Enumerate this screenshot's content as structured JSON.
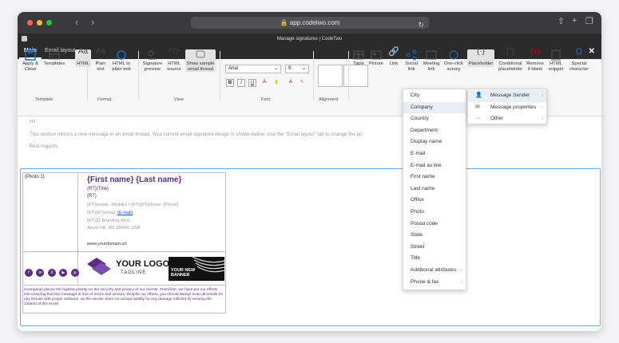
{
  "browser": {
    "url": "app.codetwo.com"
  },
  "app": {
    "title": "Manage signatures | CodeTwo"
  },
  "tabs": [
    {
      "label": "Main"
    },
    {
      "label": "Email layout"
    }
  ],
  "ribbon": {
    "template": [
      {
        "label": "Apply & Close"
      },
      {
        "label": "Templates"
      }
    ],
    "format": [
      {
        "label": "HTML"
      },
      {
        "label": "Plain text"
      },
      {
        "label": "HTML to plain text"
      }
    ],
    "view": [
      {
        "label": "Signature preview"
      },
      {
        "label": "HTML source"
      },
      {
        "label": "Show sample email thread"
      }
    ],
    "font": {
      "family": "Arial",
      "size": "9",
      "bold": "B",
      "italic": "I",
      "underline": "U"
    },
    "insert": [
      {
        "label": "Table"
      },
      {
        "label": "Picture"
      },
      {
        "label": "Link"
      },
      {
        "label": "Social link"
      },
      {
        "label": "Meeting link"
      },
      {
        "label": "One-click survey"
      },
      {
        "label": "Placeholder"
      },
      {
        "label": "Conditional placeholder"
      },
      {
        "label": "Remove if blank"
      },
      {
        "label": "HTML snippet"
      },
      {
        "label": "Special character"
      }
    ],
    "groups": {
      "template": "Template",
      "format": "Format",
      "view": "View",
      "font": "Font",
      "alignment": "Alignment"
    }
  },
  "email": {
    "hi": "Hi!",
    "body": "This section mimics a new message in an email thread. Your current email signature design is shown below. Use the \"Email layout\" tab to change the po",
    "regards": "Best regards,"
  },
  "signature": {
    "photo": "{Photo 1}",
    "name": "{First name} {Last name}",
    "title": "{RT}{Title}",
    "rt": "{RT}",
    "mobile": "{RT}mobile: {Mobile} • {RT}{RT}phone: {Phone}",
    "email_prefix": "{RT}{RT}email: ",
    "email_link": "{E-mail}",
    "address1": "{RT}22 Branding Blvd,",
    "address2": "Azure Hill, NV, 89404, USA",
    "website": "www.yourdomain.url",
    "logo_text": "YOUR LOGO",
    "logo_tagline": "TAGLINE",
    "banner_text": "YOUR NEW BANNER",
    "social": [
      "f",
      "in",
      "X",
      "▶",
      "◎"
    ],
    "disclaimer": "{Company} places the highest priority on the security and privacy of our Clients. Therefore, we have put our efforts into ensuring that this message is free of errors and viruses. Despite our efforts, you should always scan all emails for any threats with proper software, as the sender does not accept liability for any damage inflicted by viewing the content of this email."
  },
  "placeholder_menu": [
    {
      "label": "City"
    },
    {
      "label": "Company"
    },
    {
      "label": "Country"
    },
    {
      "label": "Department"
    },
    {
      "label": "Display name"
    },
    {
      "label": "E-mail"
    },
    {
      "label": "E-mail as link"
    },
    {
      "label": "First name"
    },
    {
      "label": "Last name"
    },
    {
      "label": "Office"
    },
    {
      "label": "Photo"
    },
    {
      "label": "Postal code"
    },
    {
      "label": "State"
    },
    {
      "label": "Street"
    },
    {
      "label": "Title"
    },
    {
      "label": "Additional attributes"
    },
    {
      "label": "Phone & fax"
    }
  ],
  "placeholder_submenu": [
    {
      "label": "Message Sender"
    },
    {
      "label": "Message properties"
    },
    {
      "label": "Other"
    }
  ],
  "colors": {
    "accent": "#5a2d82",
    "link": "#1155cc",
    "ribbon": "#f6f6f6"
  }
}
